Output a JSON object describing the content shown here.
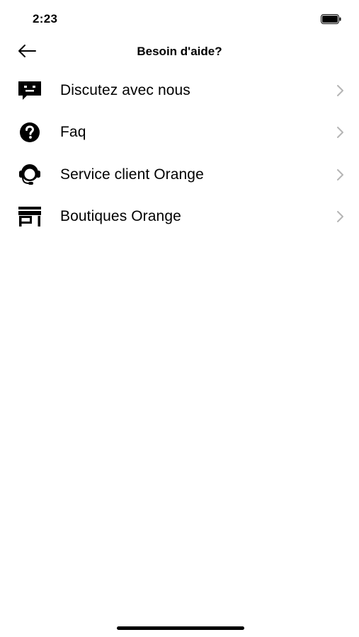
{
  "status_bar": {
    "time": "2:23",
    "battery_icon": "battery-full-icon"
  },
  "header": {
    "title": "Besoin d'aide?",
    "back_icon": "arrow-left-icon"
  },
  "menu": {
    "items": [
      {
        "label": "Discutez avec nous",
        "icon": "chat-bubble-icon"
      },
      {
        "label": "Faq",
        "icon": "question-circle-icon"
      },
      {
        "label": "Service client Orange",
        "icon": "headset-agent-icon"
      },
      {
        "label": "Boutiques Orange",
        "icon": "store-icon"
      }
    ]
  },
  "colors": {
    "background": "#ffffff",
    "text": "#000000",
    "chevron": "#b5b5b5"
  }
}
